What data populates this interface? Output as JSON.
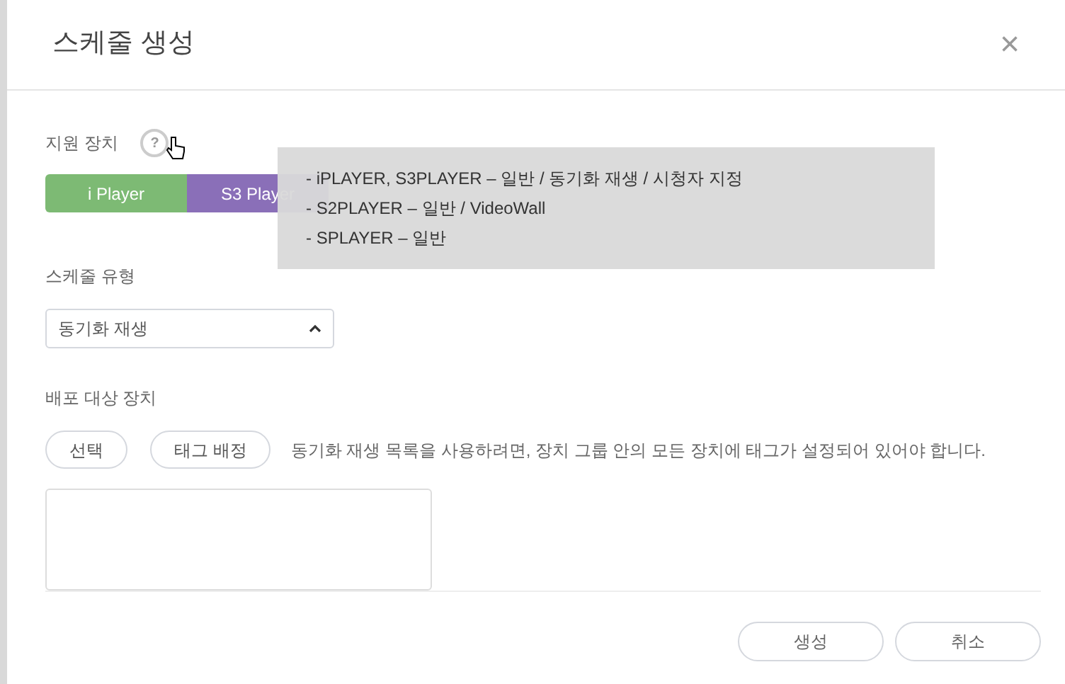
{
  "dialog": {
    "title": "스케줄 생성",
    "close_icon": "×"
  },
  "supported_devices": {
    "label": "지원 장치",
    "help_icon": "?",
    "players": [
      {
        "label": "i Player",
        "selected": true,
        "color": "#7dba74"
      },
      {
        "label": "S3 Player",
        "selected": true,
        "color": "#8a6fb8"
      }
    ],
    "tooltip": [
      "- iPLAYER, S3PLAYER – 일반 / 동기화 재생 / 시청자 지정",
      "- S2PLAYER – 일반 / VideoWall",
      "- SPLAYER – 일반"
    ]
  },
  "schedule_type": {
    "label": "스케줄 유형",
    "value": "동기화 재생",
    "expanded": true
  },
  "target_devices": {
    "label": "배포 대상 장치",
    "buttons": [
      "선택",
      "태그 배정"
    ],
    "note": "동기화 재생 목록을 사용하려면, 장치 그룹 안의 모든 장치에 태그가 설정되어 있어야 합니다."
  },
  "footer_buttons": [
    "생성",
    "취소"
  ]
}
